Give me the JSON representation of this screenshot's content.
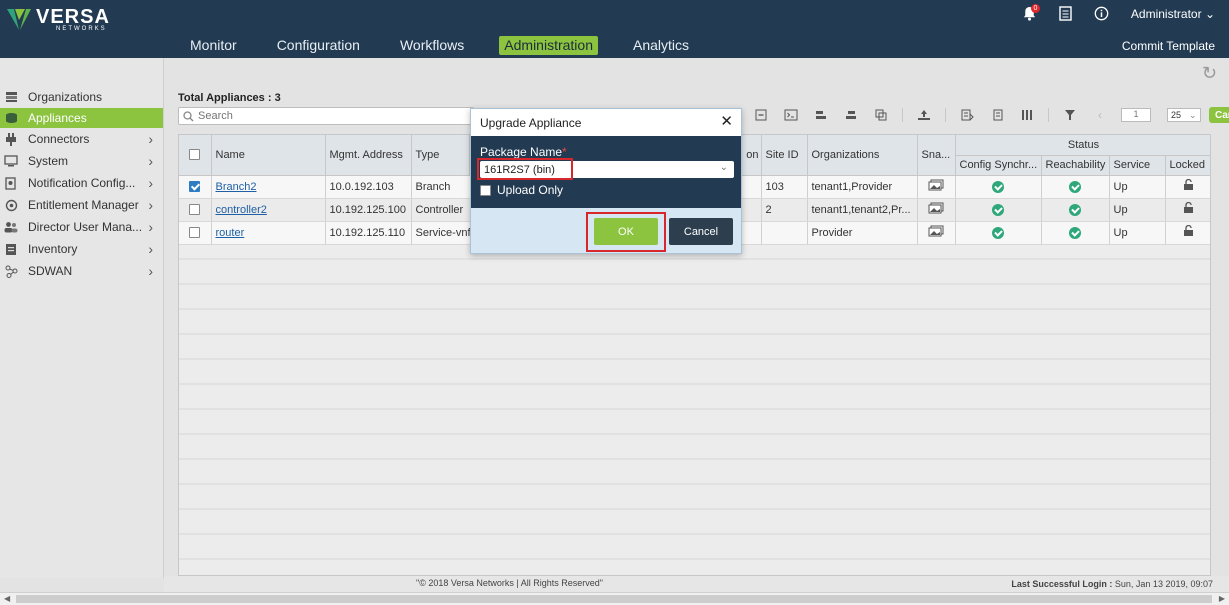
{
  "header": {
    "logo": {
      "brand": "VERSA",
      "tagline": "NETWORKS"
    },
    "notification_count": "0",
    "user_label": "Administrator",
    "commit_label": "Commit Template",
    "nav": [
      {
        "label": "Monitor"
      },
      {
        "label": "Configuration"
      },
      {
        "label": "Workflows"
      },
      {
        "label": "Administration",
        "active": true
      },
      {
        "label": "Analytics"
      }
    ]
  },
  "sidebar": {
    "items": [
      {
        "label": "Organizations",
        "icon": "organizations-icon",
        "chevron": false
      },
      {
        "label": "Appliances",
        "icon": "appliances-icon",
        "chevron": false,
        "active": true
      },
      {
        "label": "Connectors",
        "icon": "connectors-icon",
        "chevron": true
      },
      {
        "label": "System",
        "icon": "system-icon",
        "chevron": true
      },
      {
        "label": "Notification Config...",
        "icon": "notification-icon",
        "chevron": true
      },
      {
        "label": "Entitlement Manager",
        "icon": "entitlement-icon",
        "chevron": true
      },
      {
        "label": "Director User Mana...",
        "icon": "users-icon",
        "chevron": true
      },
      {
        "label": "Inventory",
        "icon": "inventory-icon",
        "chevron": true
      },
      {
        "label": "SDWAN",
        "icon": "sdwan-icon",
        "chevron": true
      }
    ]
  },
  "main": {
    "total_label": "Total Appliances : 3",
    "search_placeholder": "Search",
    "page_number": "1",
    "page_size": "25",
    "card_label": "Card",
    "table": {
      "status_group": "Status",
      "columns": [
        "Name",
        "Mgmt. Address",
        "Type",
        "on",
        "Site ID",
        "Organizations",
        "Sna...",
        "Config Synchr...",
        "Reachability",
        "Service",
        "Locked"
      ],
      "rows": [
        {
          "checked": true,
          "name": "Branch2",
          "mgmt": "10.0.192.103",
          "type": "Branch",
          "site_id": "103",
          "orgs": "tenant1,Provider",
          "config_sync": "ok",
          "reachability": "ok",
          "service": "Up"
        },
        {
          "checked": false,
          "name": "controller2",
          "mgmt": "10.192.125.100",
          "type": "Controller",
          "site_id": "2",
          "orgs": "tenant1,tenant2,Pr...",
          "config_sync": "ok",
          "reachability": "ok",
          "service": "Up"
        },
        {
          "checked": false,
          "name": "router",
          "mgmt": "10.192.125.110",
          "type": "Service-vnf",
          "site_id": "",
          "orgs": "Provider",
          "config_sync": "ok",
          "reachability": "ok",
          "service": "Up"
        }
      ]
    }
  },
  "footer": {
    "copyright": "\"© 2018 Versa Networks | All Rights Reserved\"",
    "last_login_label": "Last Successful Login :",
    "last_login_value": " Sun, Jan 13 2019, 09:07"
  },
  "modal": {
    "title": "Upgrade Appliance",
    "package_label": "Package Name",
    "required_mark": "*",
    "package_value": "161R2S7 (bin)",
    "upload_only_label": "Upload Only",
    "ok_label": "OK",
    "cancel_label": "Cancel"
  },
  "colors": {
    "header_bg": "#233b52",
    "accent_green": "#8cc33f",
    "highlight_red": "#d8262d",
    "status_ok": "#2ea87a",
    "link": "#1f5fa6"
  }
}
